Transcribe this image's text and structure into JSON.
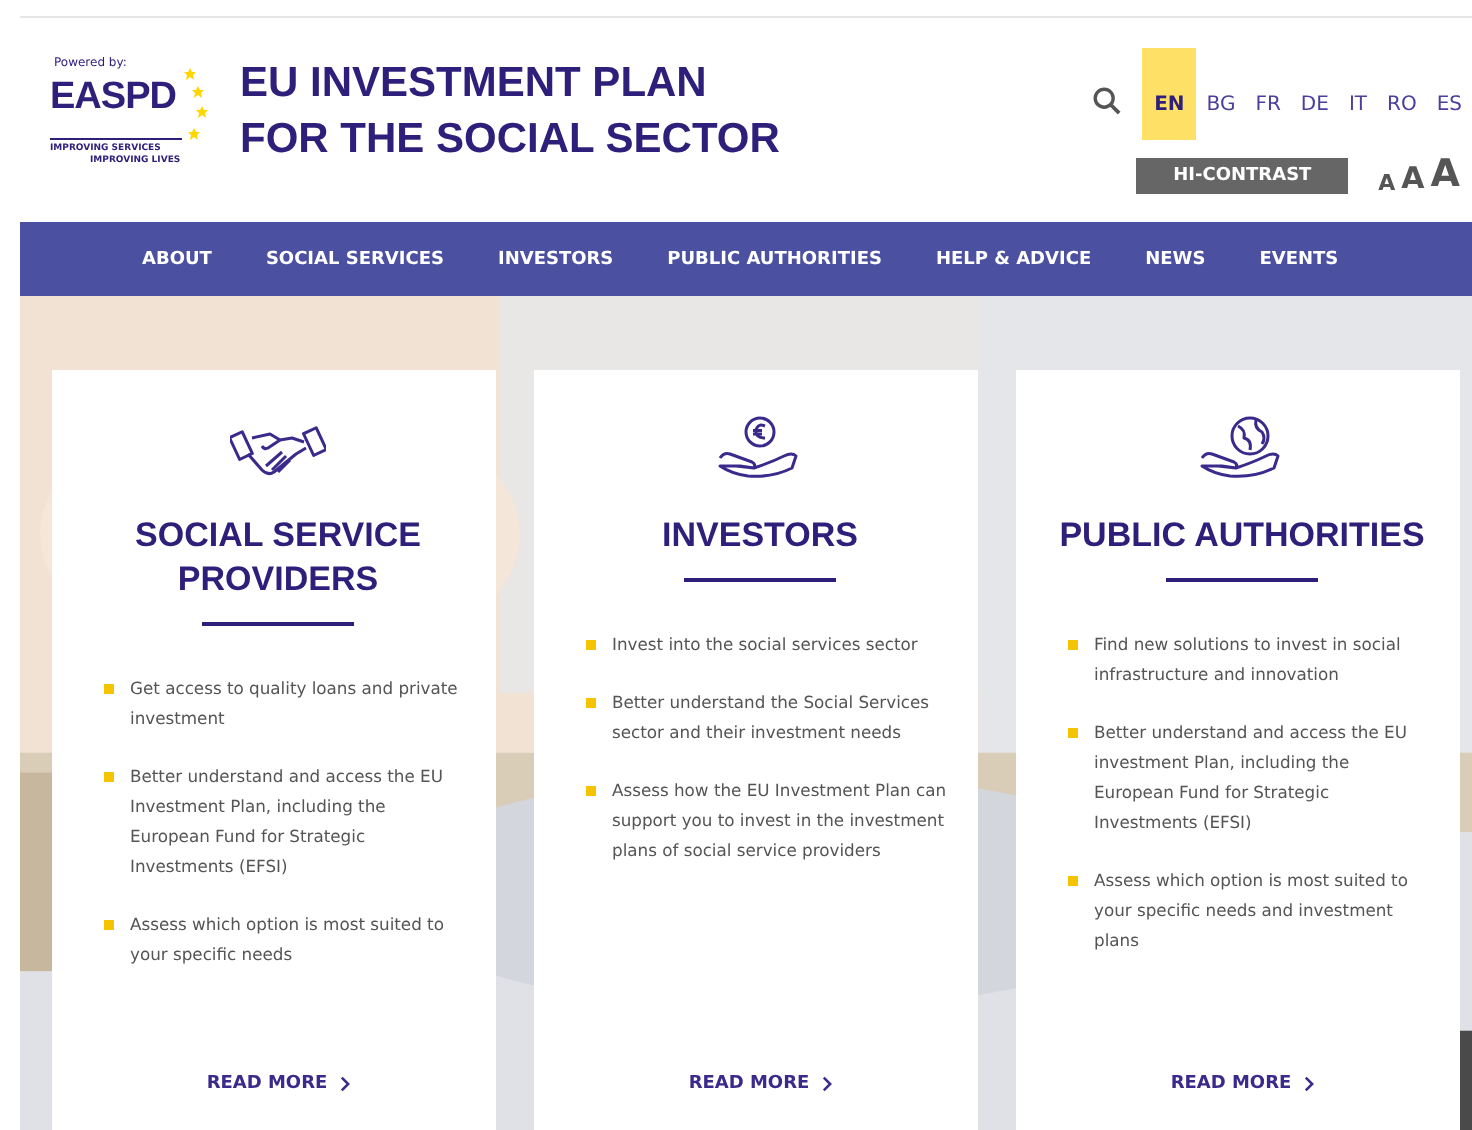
{
  "logo": {
    "powered_by": "Powered by:",
    "name": "EASPD",
    "tagline_1": "IMPROVING SERVICES",
    "tagline_2": "IMPROVING LIVES"
  },
  "site_title": {
    "line_1": "EU INVESTMENT PLAN",
    "line_2": "FOR THE SOCIAL SECTOR"
  },
  "languages": [
    {
      "label": "EN",
      "selected": true
    },
    {
      "label": "BG",
      "selected": false
    },
    {
      "label": "FR",
      "selected": false
    },
    {
      "label": "DE",
      "selected": false
    },
    {
      "label": "IT",
      "selected": false
    },
    {
      "label": "RO",
      "selected": false
    },
    {
      "label": "ES",
      "selected": false
    }
  ],
  "contrast_button": "HI-CONTRAST",
  "font_sizes": [
    "A",
    "A",
    "A"
  ],
  "nav": [
    "ABOUT",
    "SOCIAL SERVICES",
    "INVESTORS",
    "PUBLIC AUTHORITIES",
    "HELP & ADVICE",
    "NEWS",
    "EVENTS"
  ],
  "cards": [
    {
      "kind": "handshake",
      "title": "SOCIAL SERVICE PROVIDERS",
      "bullets": [
        "Get access to quality loans and private investment",
        "Better understand and access the EU Investment Plan, including the European Fund for Strategic Investments (EFSI)",
        "Assess which option is most suited to your specific needs"
      ],
      "link": "READ MORE"
    },
    {
      "kind": "coin",
      "title": "INVESTORS",
      "bullets": [
        "Invest into the social services sector",
        "Better understand the Social Services sector and their investment needs",
        "Assess how the EU Investment Plan can support you to invest in the investment plans of social service providers"
      ],
      "link": "READ MORE"
    },
    {
      "kind": "globe",
      "title": "PUBLIC AUTHORITIES",
      "bullets": [
        "Find new solutions to invest in social infrastructure and innovation",
        "Better understand and access the EU investment Plan, including the European Fund for Strategic Investments (EFSI)",
        "Assess which option is most suited to your specific needs and investment plans"
      ],
      "link": "READ MORE"
    }
  ]
}
